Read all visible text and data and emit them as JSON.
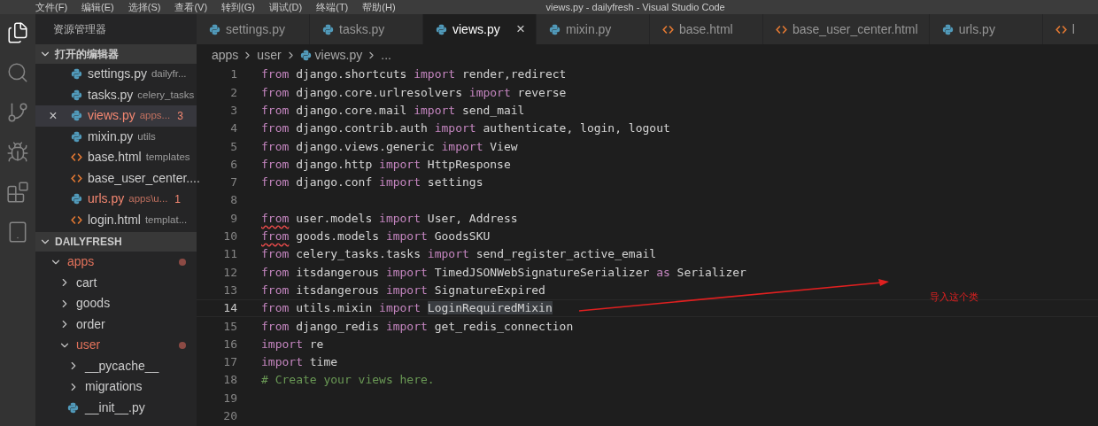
{
  "window": {
    "title": "views.py - dailyfresh - Visual Studio Code"
  },
  "menu": [
    "文件(F)",
    "编辑(E)",
    "选择(S)",
    "查看(V)",
    "转到(G)",
    "调试(D)",
    "终端(T)",
    "帮助(H)"
  ],
  "activity_bar": [
    {
      "kind": "files",
      "selected": true
    },
    {
      "kind": "search",
      "selected": false
    },
    {
      "kind": "source-control",
      "selected": false
    },
    {
      "kind": "debug",
      "selected": false
    },
    {
      "kind": "extensions",
      "selected": false
    },
    {
      "kind": "panel",
      "selected": false
    }
  ],
  "sidebar": {
    "title": "资源管理器",
    "open_editors": {
      "title": "打开的编辑器",
      "expanded": true,
      "items": [
        {
          "name": "settings.py",
          "detail": "dailyfr...",
          "kind": "python",
          "error": false,
          "selected": false
        },
        {
          "name": "tasks.py",
          "detail": "celery_tasks",
          "kind": "python",
          "error": false,
          "selected": false
        },
        {
          "name": "views.py",
          "detail": "apps...",
          "kind": "python",
          "error": true,
          "badge": "3",
          "selected": true,
          "close": "×"
        },
        {
          "name": "mixin.py",
          "detail": "utils",
          "kind": "python",
          "error": false,
          "selected": false
        },
        {
          "name": "base.html",
          "detail": "templates",
          "kind": "html",
          "error": false,
          "selected": false
        },
        {
          "name": "base_user_center....",
          "kind": "html",
          "error": false,
          "selected": false
        },
        {
          "name": "urls.py",
          "detail": "apps\\u...",
          "kind": "python",
          "error": true,
          "badge": "1",
          "selected": false
        },
        {
          "name": "login.html",
          "detail": "templat...",
          "kind": "html",
          "error": false,
          "selected": false
        }
      ]
    },
    "project": {
      "title": "DAILYFRESH",
      "expanded": true,
      "tree": [
        {
          "name": "apps",
          "kind": "folder",
          "expanded": true,
          "modified": true,
          "children": [
            {
              "name": "cart",
              "kind": "folder",
              "expanded": false,
              "modified": false
            },
            {
              "name": "goods",
              "kind": "folder",
              "expanded": false,
              "modified": false
            },
            {
              "name": "order",
              "kind": "folder",
              "expanded": false,
              "modified": false
            },
            {
              "name": "user",
              "kind": "folder",
              "expanded": true,
              "modified": true,
              "children": [
                {
                  "name": "__pycache__",
                  "kind": "folder",
                  "expanded": false,
                  "modified": false
                },
                {
                  "name": "migrations",
                  "kind": "folder",
                  "expanded": false,
                  "modified": false
                },
                {
                  "name": "__init__.py",
                  "kind": "python",
                  "modified": false
                }
              ]
            }
          ]
        }
      ]
    }
  },
  "tabs": [
    {
      "label": "settings.py",
      "kind": "python",
      "selected": false
    },
    {
      "label": "tasks.py",
      "kind": "python",
      "selected": false
    },
    {
      "label": "views.py",
      "kind": "python",
      "selected": true,
      "close": "×"
    },
    {
      "label": "mixin.py",
      "kind": "python",
      "selected": false
    },
    {
      "label": "base.html",
      "kind": "html",
      "selected": false
    },
    {
      "label": "base_user_center.html",
      "kind": "html",
      "selected": false
    },
    {
      "label": "urls.py",
      "kind": "python",
      "selected": false
    },
    {
      "label": "l",
      "kind": "html",
      "selected": false
    }
  ],
  "breadcrumb": [
    {
      "label": "apps",
      "kind": "folder"
    },
    {
      "label": "user",
      "kind": "folder"
    },
    {
      "label": "views.py",
      "kind": "python"
    },
    {
      "label": "...",
      "kind": "more"
    }
  ],
  "editor": {
    "lines": [
      {
        "number": "1",
        "current": false,
        "tokens": [
          {
            "kind": "keyword",
            "text": "from"
          },
          {
            "kind": "plain",
            "text": " django.shortcuts "
          },
          {
            "kind": "keyword",
            "text": "import"
          },
          {
            "kind": "plain",
            "text": " render,redirect"
          }
        ]
      },
      {
        "number": "2",
        "current": false,
        "tokens": [
          {
            "kind": "keyword",
            "text": "from"
          },
          {
            "kind": "plain",
            "text": " django.core.urlresolvers "
          },
          {
            "kind": "keyword",
            "text": "import"
          },
          {
            "kind": "plain",
            "text": " reverse"
          }
        ]
      },
      {
        "number": "3",
        "current": false,
        "tokens": [
          {
            "kind": "keyword",
            "text": "from"
          },
          {
            "kind": "plain",
            "text": " django.core.mail "
          },
          {
            "kind": "keyword",
            "text": "import"
          },
          {
            "kind": "plain",
            "text": " send_mail"
          }
        ]
      },
      {
        "number": "4",
        "current": false,
        "tokens": [
          {
            "kind": "keyword",
            "text": "from"
          },
          {
            "kind": "plain",
            "text": " django.contrib.auth "
          },
          {
            "kind": "keyword",
            "text": "import"
          },
          {
            "kind": "plain",
            "text": " authenticate, login, logout"
          }
        ]
      },
      {
        "number": "5",
        "current": false,
        "tokens": [
          {
            "kind": "keyword",
            "text": "from"
          },
          {
            "kind": "plain",
            "text": " django.views.generic "
          },
          {
            "kind": "keyword",
            "text": "import"
          },
          {
            "kind": "plain",
            "text": " View"
          }
        ]
      },
      {
        "number": "6",
        "current": false,
        "tokens": [
          {
            "kind": "keyword",
            "text": "from"
          },
          {
            "kind": "plain",
            "text": " django.http "
          },
          {
            "kind": "keyword",
            "text": "import"
          },
          {
            "kind": "plain",
            "text": " HttpResponse"
          }
        ]
      },
      {
        "number": "7",
        "current": false,
        "tokens": [
          {
            "kind": "keyword",
            "text": "from"
          },
          {
            "kind": "plain",
            "text": " django.conf "
          },
          {
            "kind": "keyword",
            "text": "import"
          },
          {
            "kind": "plain",
            "text": " settings"
          }
        ]
      },
      {
        "number": "8",
        "current": false
      },
      {
        "number": "9",
        "current": false,
        "tokens": [
          {
            "kind": "keyword",
            "text": "from",
            "error": true
          },
          {
            "kind": "plain",
            "text": " user.models "
          },
          {
            "kind": "keyword",
            "text": "import"
          },
          {
            "kind": "plain",
            "text": " User, Address"
          }
        ]
      },
      {
        "number": "10",
        "current": false,
        "tokens": [
          {
            "kind": "keyword",
            "text": "from",
            "error": true
          },
          {
            "kind": "plain",
            "text": " goods.models "
          },
          {
            "kind": "keyword",
            "text": "import"
          },
          {
            "kind": "plain",
            "text": " GoodsSKU"
          }
        ]
      },
      {
        "number": "11",
        "current": false,
        "tokens": [
          {
            "kind": "keyword",
            "text": "from"
          },
          {
            "kind": "plain",
            "text": " celery_tasks.tasks "
          },
          {
            "kind": "keyword",
            "text": "import"
          },
          {
            "kind": "plain",
            "text": " send_register_active_email"
          }
        ]
      },
      {
        "number": "12",
        "current": false,
        "tokens": [
          {
            "kind": "keyword",
            "text": "from"
          },
          {
            "kind": "plain",
            "text": " itsdangerous "
          },
          {
            "kind": "keyword",
            "text": "import"
          },
          {
            "kind": "plain",
            "text": " TimedJSONWebSignatureSerializer "
          },
          {
            "kind": "keyword",
            "text": "as"
          },
          {
            "kind": "plain",
            "text": " Serializer"
          }
        ]
      },
      {
        "number": "13",
        "current": false,
        "tokens": [
          {
            "kind": "keyword",
            "text": "from"
          },
          {
            "kind": "plain",
            "text": " itsdangerous "
          },
          {
            "kind": "keyword",
            "text": "import"
          },
          {
            "kind": "plain",
            "text": " SignatureExpired"
          }
        ]
      },
      {
        "number": "14",
        "current": true,
        "tokens": [
          {
            "kind": "keyword",
            "text": "from"
          },
          {
            "kind": "plain",
            "text": " utils.mixin "
          },
          {
            "kind": "keyword",
            "text": "import "
          },
          {
            "kind": "plain",
            "text": "LoginRequiredMixin",
            "highlighted": true
          }
        ]
      },
      {
        "number": "15",
        "current": false,
        "tokens": [
          {
            "kind": "keyword",
            "text": "from"
          },
          {
            "kind": "plain",
            "text": " django_redis "
          },
          {
            "kind": "keyword",
            "text": "import"
          },
          {
            "kind": "plain",
            "text": " get_redis_connection"
          }
        ]
      },
      {
        "number": "16",
        "current": false,
        "tokens": [
          {
            "kind": "keyword",
            "text": "import"
          },
          {
            "kind": "plain",
            "text": " re"
          }
        ]
      },
      {
        "number": "17",
        "current": false,
        "tokens": [
          {
            "kind": "keyword",
            "text": "import"
          },
          {
            "kind": "plain",
            "text": " time"
          }
        ]
      },
      {
        "number": "18",
        "current": false,
        "tokens": [
          {
            "kind": "comment",
            "text": "# Create your views here."
          }
        ]
      },
      {
        "number": "19",
        "current": false
      },
      {
        "number": "20",
        "current": false
      }
    ]
  },
  "annotation": {
    "text": "导入这个类",
    "color": "#e02020"
  }
}
